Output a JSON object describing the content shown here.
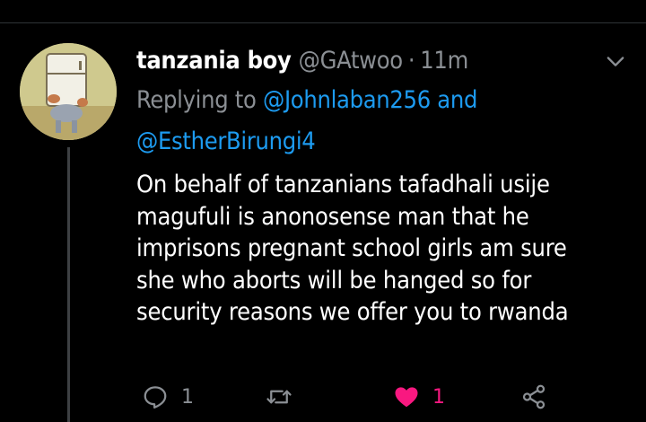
{
  "tweet": {
    "author_name": "tanzania boy",
    "handle": "@GAtwoo",
    "separator": "·",
    "timestamp": "11m",
    "replying_prefix": "Replying to",
    "reply_mentions": [
      "@Johnlaban256",
      "@EstherBirungi4"
    ],
    "reply_joiner": "and",
    "text_lines": [
      "On behalf of tanzanians tafadhali usije",
      "magufuli is anonosense man that he",
      "imprisons pregnant school girls am sure",
      "she who aborts will be hanged so for",
      "security reasons we offer you to rwanda"
    ],
    "actions": {
      "reply_count": "1",
      "retweet_count": "",
      "like_count": "1"
    },
    "icons": {
      "reply": "reply-icon",
      "retweet": "retweet-icon",
      "like": "heart-icon",
      "share": "share-icon",
      "menu": "chevron-down-icon"
    }
  },
  "colors": {
    "background": "#000000",
    "link": "#1d9bf0",
    "muted": "#8b8f94",
    "like": "#f91880"
  }
}
